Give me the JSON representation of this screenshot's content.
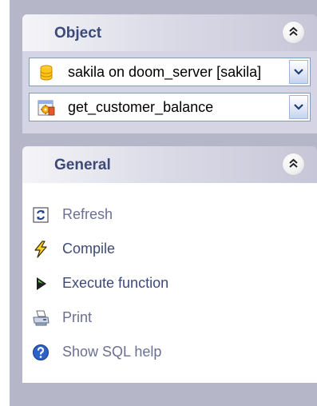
{
  "object_panel": {
    "title": "Object",
    "database_combo": {
      "value": "sakila on doom_server [sakila]"
    },
    "object_combo": {
      "value": "get_customer_balance"
    }
  },
  "general_panel": {
    "title": "General",
    "items": [
      {
        "label": "Refresh",
        "icon": "refresh-icon"
      },
      {
        "label": "Compile",
        "icon": "lightning-icon"
      },
      {
        "label": "Execute function",
        "icon": "play-icon"
      },
      {
        "label": "Print",
        "icon": "printer-icon"
      },
      {
        "label": "Show SQL help",
        "icon": "help-icon"
      }
    ]
  },
  "colors": {
    "header_text": "#3d4a78",
    "panel_bg": "#d4d4e4",
    "frame_bg": "#b6b6c9"
  }
}
